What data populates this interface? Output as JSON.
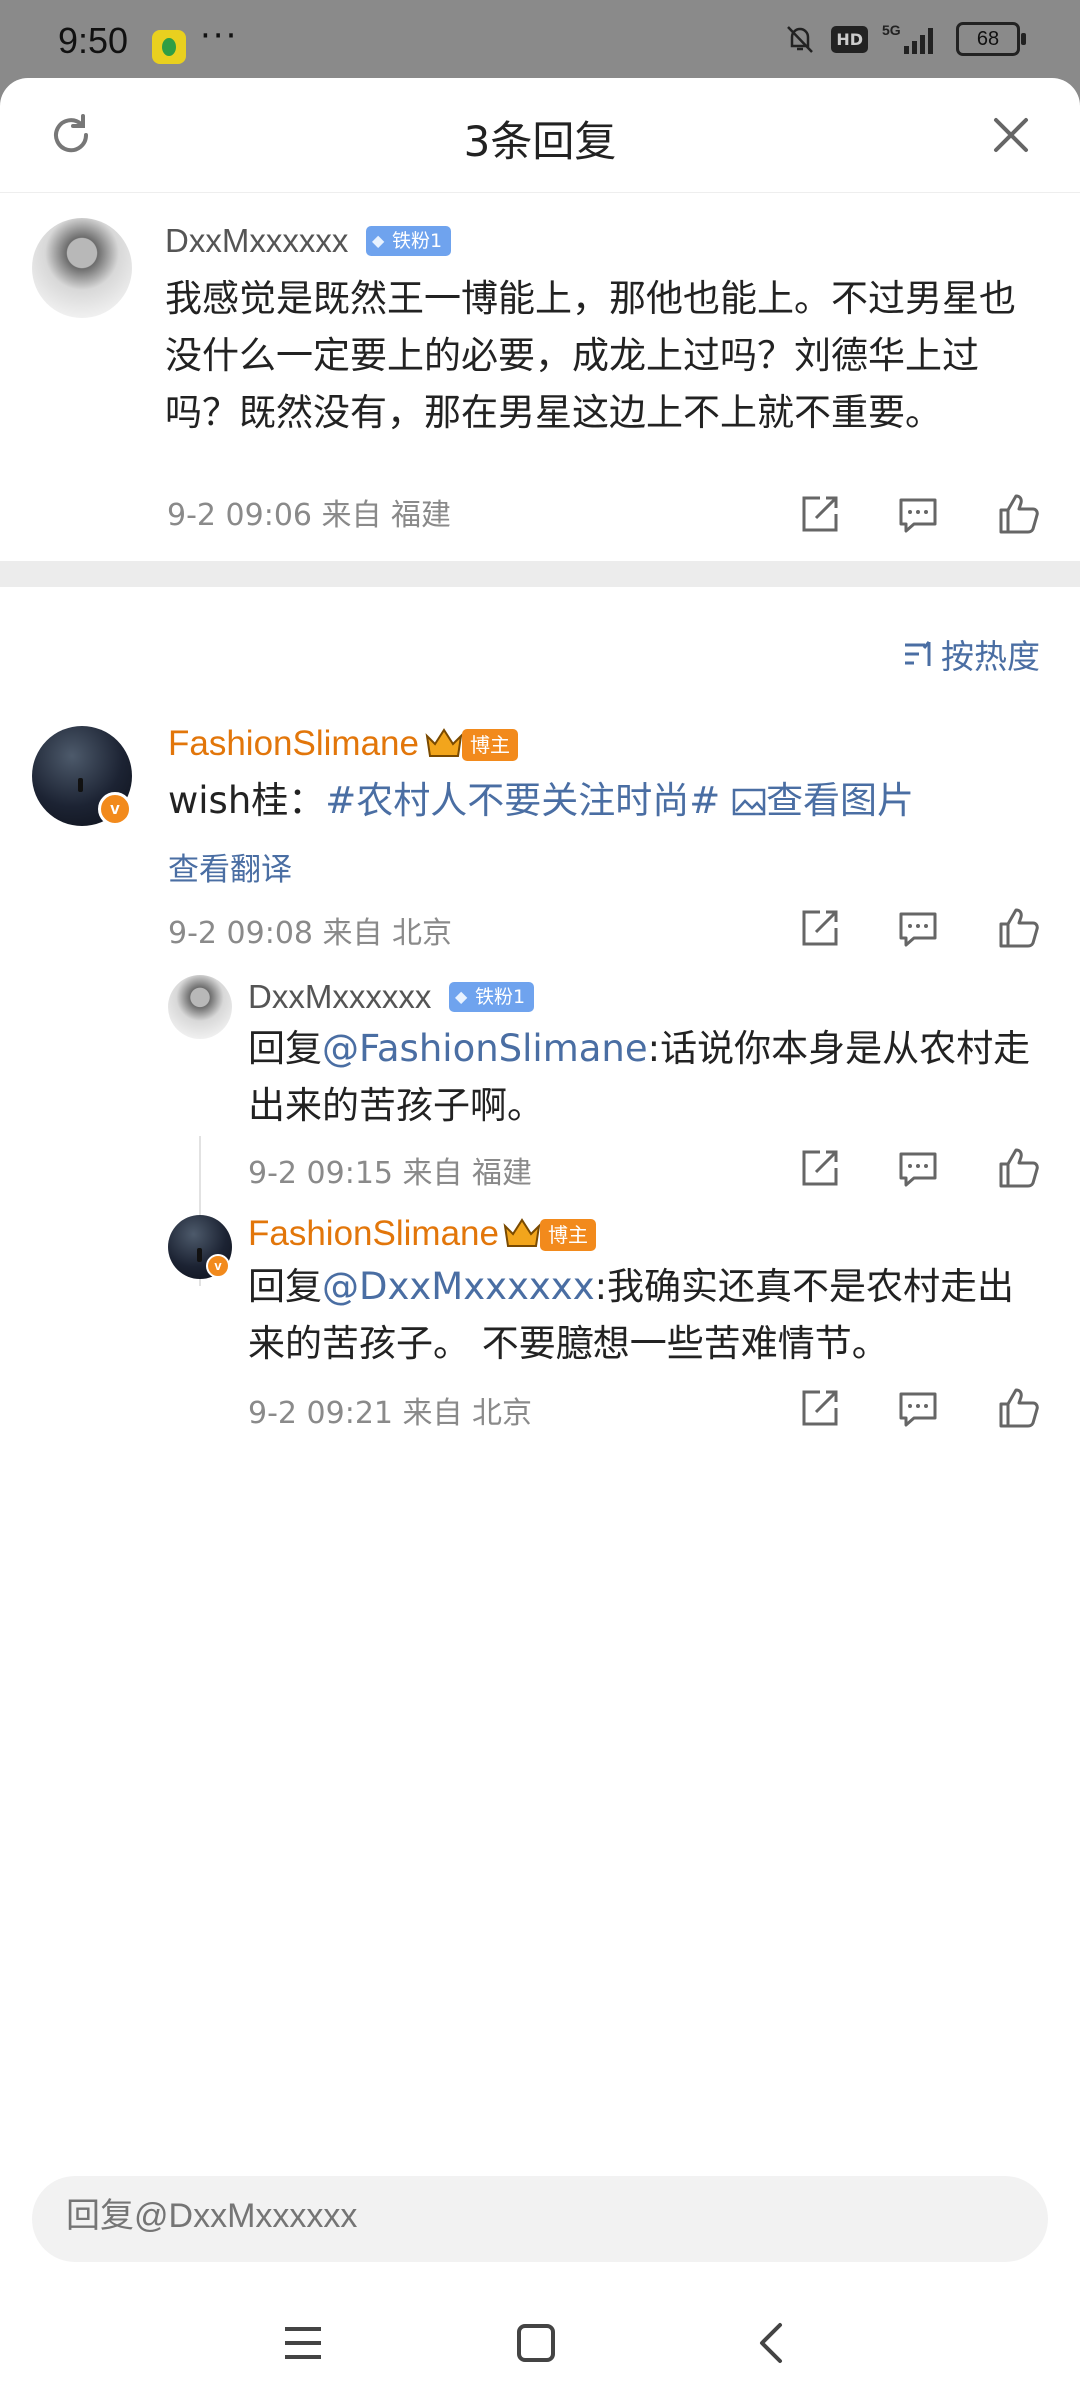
{
  "status_bar": {
    "time": "9:50",
    "dots": "···",
    "hd": "HD",
    "network": "5G",
    "battery": "68"
  },
  "header": {
    "title": "3条回复"
  },
  "root_comment": {
    "user": "DxxMxxxxxx",
    "badge": "铁粉1",
    "text": "我感觉是既然王一博能上，那他也能上。不过男星也没什么一定要上的必要，成龙上过吗？刘德华上过吗？既然没有，那在男星这边上不上就不重要。",
    "meta": "9-2 09:06  来自 福建"
  },
  "sort": {
    "label": "按热度"
  },
  "reply1": {
    "user": "FashionSlimane",
    "badge": "博主",
    "prefix": "wish桂：",
    "hashtag": "#农村人不要关注时尚#",
    "image_link": "查看图片",
    "translate": "查看翻译",
    "meta": "9-2 09:08  来自 北京"
  },
  "reply2": {
    "user": "DxxMxxxxxx",
    "badge": "铁粉1",
    "prefix": "回复",
    "mention": "@FashionSlimane",
    "text": ":话说你本身是从农村走出来的苦孩子啊。",
    "meta": "9-2 09:15  来自 福建"
  },
  "reply3": {
    "user": "FashionSlimane",
    "badge": "博主",
    "prefix": "回复",
    "mention": "@DxxMxxxxxx",
    "text": ":我确实还真不是农村走出来的苦孩子。 不要臆想一些苦难情节。",
    "meta": "9-2 09:21  来自 北京"
  },
  "reply_box": {
    "placeholder": "回复@DxxMxxxxxx"
  },
  "icons": {
    "refresh": "refresh-icon",
    "close": "close-icon",
    "share": "share-icon",
    "comment": "comment-icon",
    "like": "like-icon",
    "sort": "sort-icon",
    "image": "image-icon",
    "crown": "crown-icon",
    "nav_menu": "menu-icon",
    "nav_home": "home-icon",
    "nav_back": "back-icon"
  },
  "colors": {
    "accent_orange": "#e2760a",
    "link_blue": "#4a6ea3",
    "fan_badge": "#6fa3ee",
    "blogger_badge": "#f28a1c"
  }
}
